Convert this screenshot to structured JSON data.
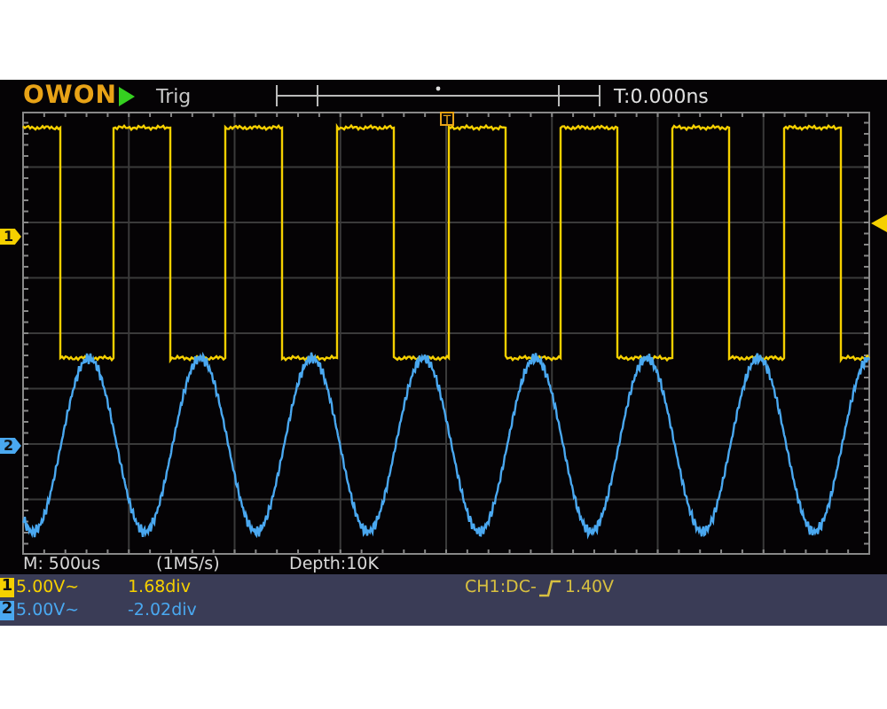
{
  "header": {
    "logo": "OWON",
    "trigger_status": "Trig",
    "trigger_time": "T:0.000ns"
  },
  "trigger_position_marker": "T",
  "channels": [
    {
      "marker": "1",
      "badge": "1",
      "color": "#f5d000",
      "scale": "5.00V~",
      "position": "1.68div",
      "kind": "square"
    },
    {
      "marker": "2",
      "badge": "2",
      "color": "#4aa8f0",
      "scale": "5.00V~",
      "position": "-2.02div",
      "kind": "sine"
    }
  ],
  "info": {
    "timebase": "M: 500us",
    "sample_rate": "(1MS/s)",
    "depth": "Depth:10K"
  },
  "trigger": {
    "source": "CH1:DC-",
    "level": "1.40V"
  }
}
